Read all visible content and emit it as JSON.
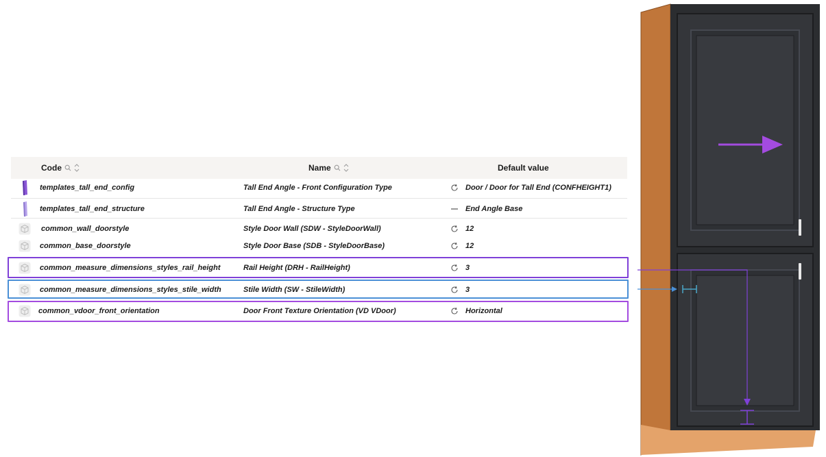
{
  "table": {
    "headers": {
      "code": "Code",
      "name": "Name",
      "default_value": "Default value"
    },
    "rows": [
      {
        "icon": "purple-panel-icon",
        "code": "templates_tall_end_config",
        "name": "Tall End Angle - Front Configuration Type",
        "default_icon": "refresh-icon",
        "default_value": "Door / Door for Tall End (CONFHEIGHT1)"
      },
      {
        "icon": "lilac-panel-icon",
        "code": "templates_tall_end_structure",
        "name": "Tall End Angle - Structure Type",
        "default_icon": "dash-icon",
        "default_value": "End Angle Base"
      },
      {
        "icon": "cube-icon",
        "code": "common_wall_doorstyle",
        "name": "Style Door Wall (SDW - StyleDoorWall)",
        "default_icon": "refresh-icon",
        "default_value": "12"
      },
      {
        "icon": "cube-icon",
        "code": "common_base_doorstyle",
        "name": "Style Door Base (SDB - StyleDoorBase)",
        "default_icon": "refresh-icon",
        "default_value": "12"
      },
      {
        "icon": "cube-icon",
        "code": "common_measure_dimensions_styles_rail_height",
        "name": "Rail Height (DRH - RailHeight)",
        "default_icon": "refresh-icon",
        "default_value": "3"
      },
      {
        "icon": "cube-icon",
        "code": "common_measure_dimensions_styles_stile_width",
        "name": "Stile Width (SW - StileWidth)",
        "default_icon": "refresh-icon",
        "default_value": "3"
      },
      {
        "icon": "cube-icon",
        "code": "common_vdoor_front_orientation",
        "name": "Door Front Texture Orientation (VD VDoor)",
        "default_icon": "refresh-icon",
        "default_value": "Horizontal"
      }
    ]
  },
  "colors": {
    "rail_highlight": "#7f40d8",
    "stile_highlight": "#4a8fd6",
    "orientation_highlight": "#a34be0",
    "cabinet_front": "#2b2d30",
    "cabinet_side": "#c0763a"
  }
}
